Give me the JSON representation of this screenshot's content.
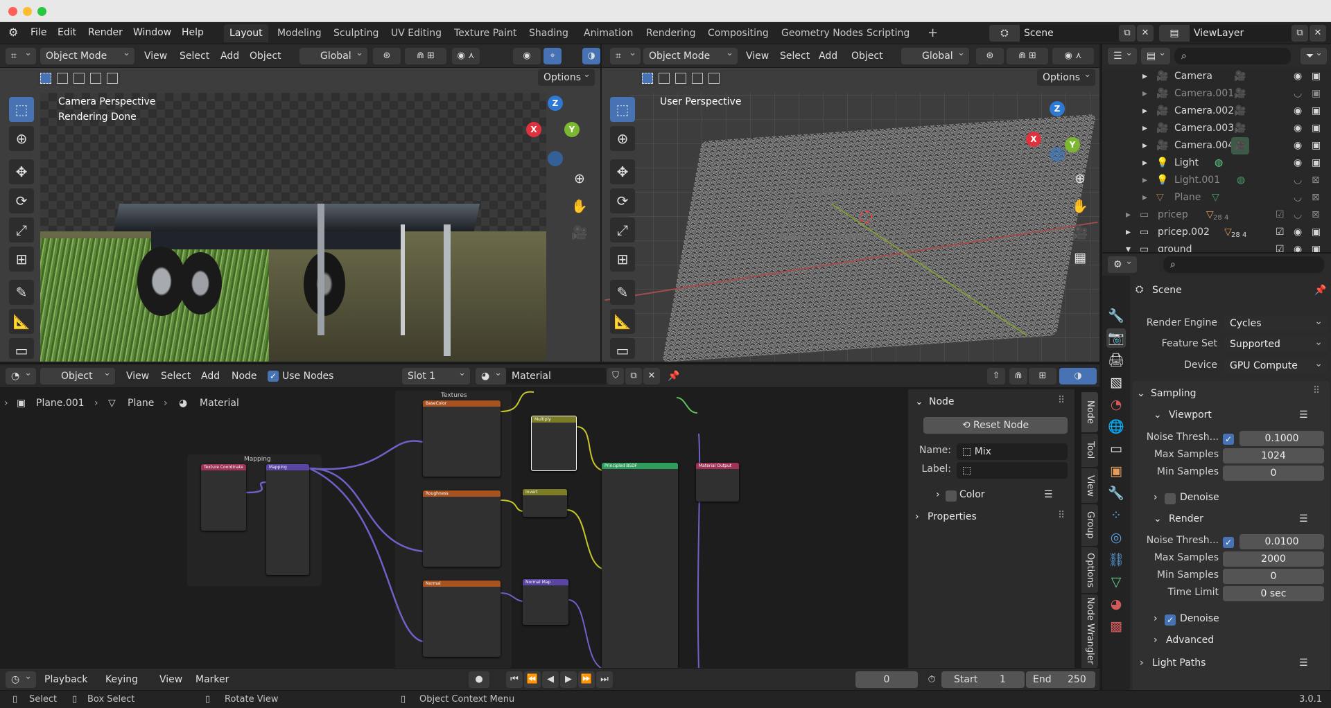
{
  "menu": {
    "file": "File",
    "edit": "Edit",
    "render": "Render",
    "window": "Window",
    "help": "Help"
  },
  "workspaces": [
    "Layout",
    "Modeling",
    "Sculpting",
    "UV Editing",
    "Texture Paint",
    "Shading",
    "Animation",
    "Rendering",
    "Compositing",
    "Geometry Nodes",
    "Scripting"
  ],
  "workspace_add": "+",
  "scene": {
    "name": "Scene"
  },
  "view_layer": {
    "name": "ViewLayer"
  },
  "viewport_left": {
    "mode": "Object Mode",
    "menus": [
      "View",
      "Select",
      "Add",
      "Object"
    ],
    "orientation": "Global",
    "options": "Options",
    "overlay1": "Camera Perspective",
    "overlay2": "Rendering Done"
  },
  "viewport_right": {
    "mode": "Object Mode",
    "menus": [
      "View",
      "Select",
      "Add",
      "Object"
    ],
    "orientation": "Global",
    "options": "Options",
    "overlay1": "User Perspective"
  },
  "gizmo": {
    "x": "X",
    "y": "Y",
    "z": "Z"
  },
  "outliner": {
    "items": [
      {
        "name": "Camera",
        "visible": true
      },
      {
        "name": "Camera.001",
        "visible": false
      },
      {
        "name": "Camera.002",
        "visible": true
      },
      {
        "name": "Camera.003",
        "visible": true
      },
      {
        "name": "Camera.004",
        "visible": true
      },
      {
        "name": "Light",
        "visible": true
      },
      {
        "name": "Light.001",
        "visible": false
      },
      {
        "name": "Plane",
        "visible": false
      },
      {
        "name": "pricep",
        "visible": false,
        "badge1": "28",
        "badge2": "4"
      },
      {
        "name": "pricep.002",
        "visible": true,
        "badge1": "28",
        "badge2": "4"
      },
      {
        "name": "ground",
        "visible": true
      }
    ]
  },
  "properties": {
    "context": "Scene",
    "render_engine_label": "Render Engine",
    "render_engine": "Cycles",
    "feature_set_label": "Feature Set",
    "feature_set": "Supported",
    "device_label": "Device",
    "device": "GPU Compute",
    "sampling": "Sampling",
    "viewport": "Viewport",
    "vp_noise_label": "Noise Thresh...",
    "vp_noise": "0.1000",
    "vp_max_label": "Max Samples",
    "vp_max": "1024",
    "vp_min_label": "Min Samples",
    "vp_min": "0",
    "vp_denoise": "Denoise",
    "render": "Render",
    "r_noise_label": "Noise Thresh...",
    "r_noise": "0.0100",
    "r_max_label": "Max Samples",
    "r_max": "2000",
    "r_min_label": "Min Samples",
    "r_min": "0",
    "r_time_label": "Time Limit",
    "r_time": "0 sec",
    "r_denoise": "Denoise",
    "advanced": "Advanced",
    "light_paths": "Light Paths"
  },
  "node_editor": {
    "type": "Object",
    "menus": [
      "View",
      "Select",
      "Add",
      "Node"
    ],
    "use_nodes": "Use Nodes",
    "slot": "Slot 1",
    "material": "Material",
    "breadcrumb": [
      "Plane.001",
      "Plane",
      "Material"
    ],
    "frame_textures": "Textures",
    "frame_mapping": "Mapping",
    "nodes": {
      "texcoord": "Texture Coordinate",
      "mapping": "Mapping",
      "basecolor": "BaseColor",
      "roughness": "Roughness",
      "normal": "Normal",
      "multiply": "Multiply",
      "invert": "Invert",
      "normalmap": "Normal Map",
      "bsdf": "Principled BSDF",
      "output": "Material Output"
    }
  },
  "npanel": {
    "node_header": "Node",
    "reset": "Reset Node",
    "name_label": "Name:",
    "name_value": "Mix",
    "label_label": "Label:",
    "label_value": "",
    "color": "Color",
    "properties": "Properties",
    "tabs": [
      "Node",
      "Tool",
      "View",
      "Group",
      "Options",
      "Node Wrangler"
    ]
  },
  "timeline": {
    "playback": "Playback",
    "keying": "Keying",
    "view": "View",
    "marker": "Marker",
    "current_frame": "0",
    "start_label": "Start",
    "start": "1",
    "end_label": "End",
    "end": "250"
  },
  "status": {
    "select": "Select",
    "box_select": "Box Select",
    "rotate_view": "Rotate View",
    "context_menu": "Object Context Menu",
    "version": "3.0.1"
  }
}
